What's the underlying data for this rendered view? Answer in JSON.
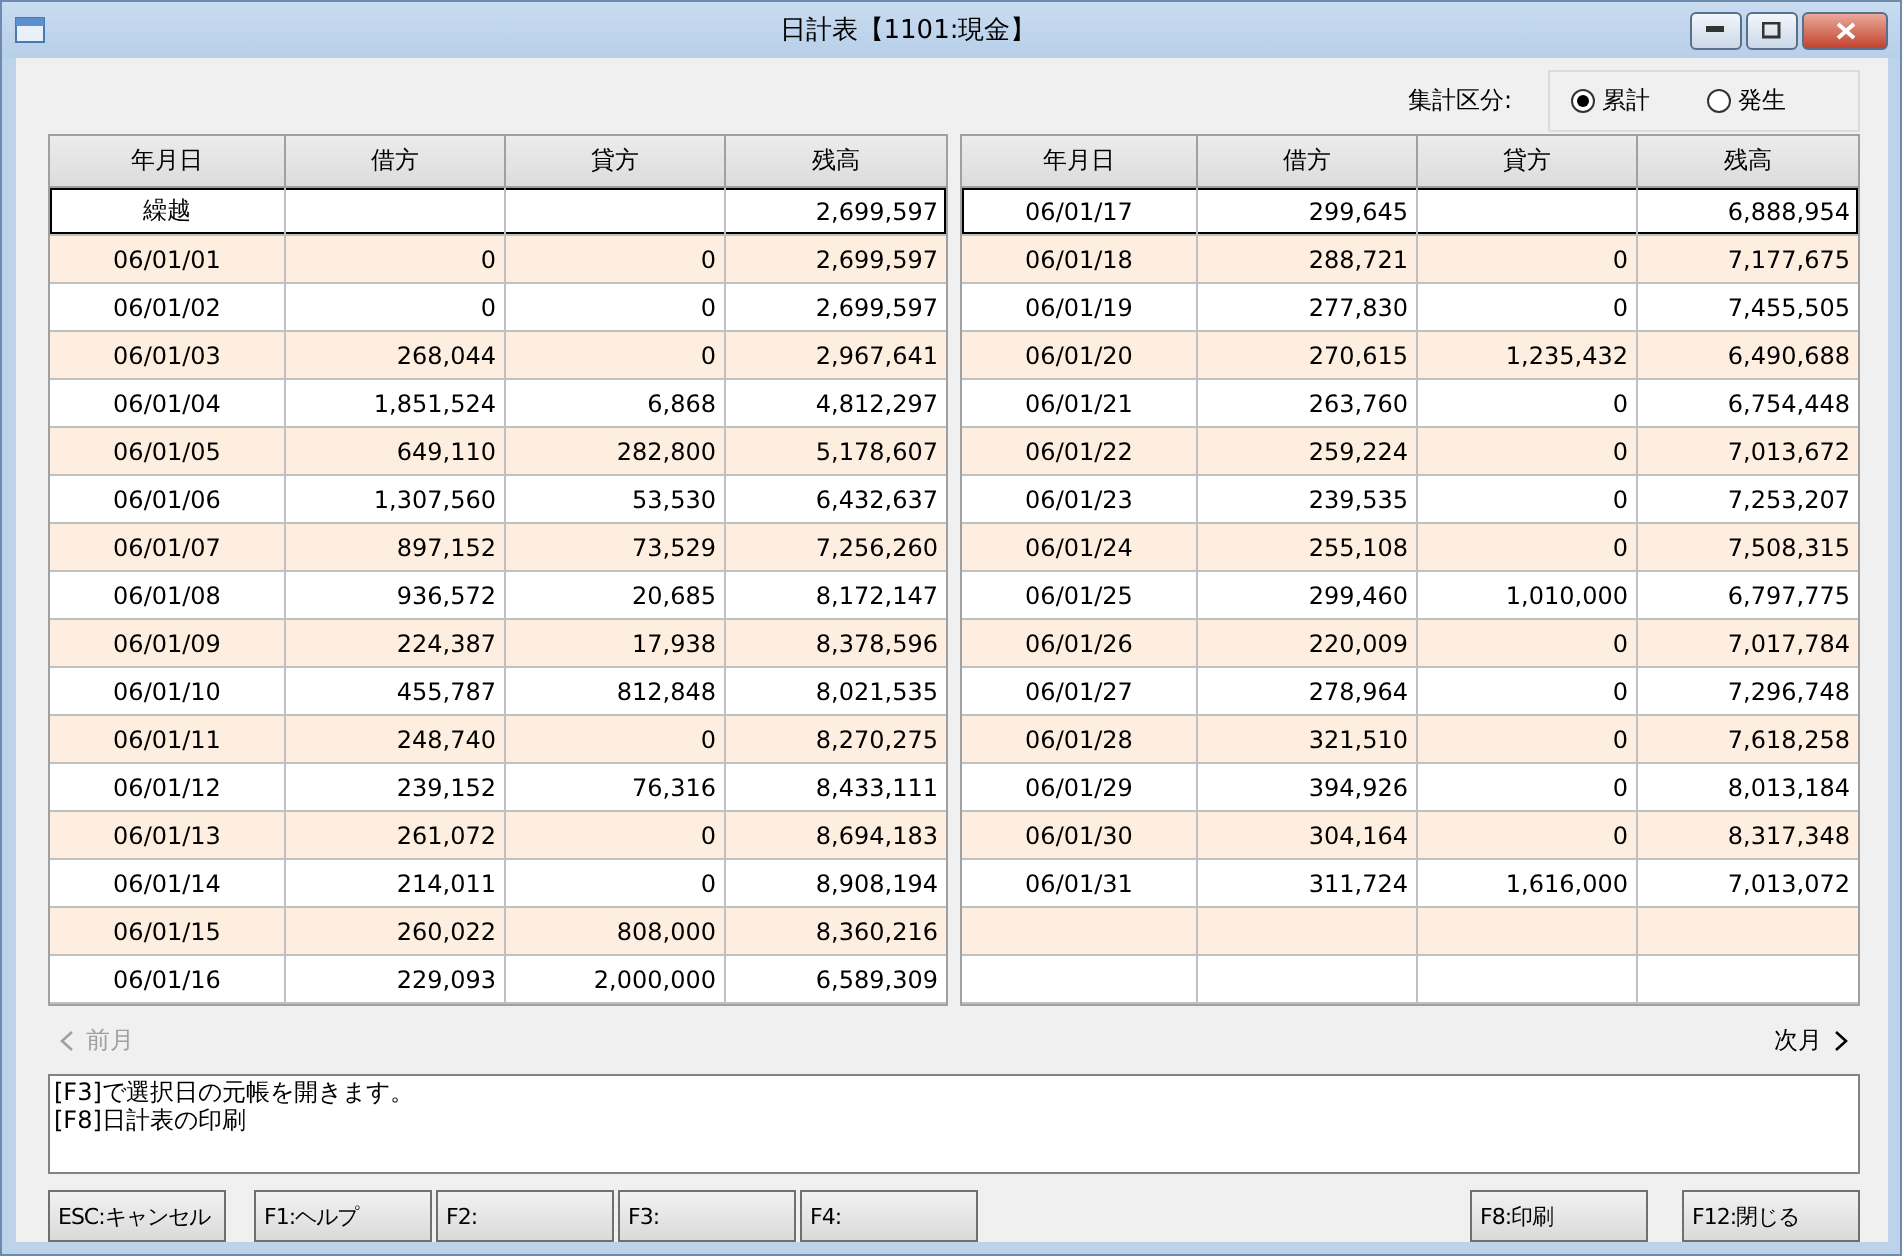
{
  "window": {
    "title": "日計表【1101:現金】"
  },
  "summary": {
    "label": "集計区分:",
    "options": [
      {
        "label": "累計",
        "selected": true
      },
      {
        "label": "発生",
        "selected": false
      }
    ]
  },
  "tables": [
    {
      "columns": [
        "年月日",
        "借方",
        "貸方",
        "残高"
      ],
      "rows": [
        {
          "cells": [
            "繰越",
            null,
            null,
            "2,699,597"
          ],
          "focused": true
        },
        {
          "cells": [
            "06/01/01",
            "0",
            "0",
            "2,699,597"
          ],
          "focused": false
        },
        {
          "cells": [
            "06/01/02",
            "0",
            "0",
            "2,699,597"
          ],
          "focused": false
        },
        {
          "cells": [
            "06/01/03",
            "268,044",
            "0",
            "2,967,641"
          ],
          "focused": false
        },
        {
          "cells": [
            "06/01/04",
            "1,851,524",
            "6,868",
            "4,812,297"
          ],
          "focused": false
        },
        {
          "cells": [
            "06/01/05",
            "649,110",
            "282,800",
            "5,178,607"
          ],
          "focused": false
        },
        {
          "cells": [
            "06/01/06",
            "1,307,560",
            "53,530",
            "6,432,637"
          ],
          "focused": false
        },
        {
          "cells": [
            "06/01/07",
            "897,152",
            "73,529",
            "7,256,260"
          ],
          "focused": false
        },
        {
          "cells": [
            "06/01/08",
            "936,572",
            "20,685",
            "8,172,147"
          ],
          "focused": false
        },
        {
          "cells": [
            "06/01/09",
            "224,387",
            "17,938",
            "8,378,596"
          ],
          "focused": false
        },
        {
          "cells": [
            "06/01/10",
            "455,787",
            "812,848",
            "8,021,535"
          ],
          "focused": false
        },
        {
          "cells": [
            "06/01/11",
            "248,740",
            "0",
            "8,270,275"
          ],
          "focused": false
        },
        {
          "cells": [
            "06/01/12",
            "239,152",
            "76,316",
            "8,433,111"
          ],
          "focused": false
        },
        {
          "cells": [
            "06/01/13",
            "261,072",
            "0",
            "8,694,183"
          ],
          "focused": false
        },
        {
          "cells": [
            "06/01/14",
            "214,011",
            "0",
            "8,908,194"
          ],
          "focused": false
        },
        {
          "cells": [
            "06/01/15",
            "260,022",
            "808,000",
            "8,360,216"
          ],
          "focused": false
        },
        {
          "cells": [
            "06/01/16",
            "229,093",
            "2,000,000",
            "6,589,309"
          ],
          "focused": false
        }
      ]
    },
    {
      "columns": [
        "年月日",
        "借方",
        "貸方",
        "残高"
      ],
      "rows": [
        {
          "cells": [
            "06/01/17",
            "299,645",
            null,
            "6,888,954"
          ],
          "focused": true
        },
        {
          "cells": [
            "06/01/18",
            "288,721",
            "0",
            "7,177,675"
          ],
          "focused": false
        },
        {
          "cells": [
            "06/01/19",
            "277,830",
            "0",
            "7,455,505"
          ],
          "focused": false
        },
        {
          "cells": [
            "06/01/20",
            "270,615",
            "1,235,432",
            "6,490,688"
          ],
          "focused": false
        },
        {
          "cells": [
            "06/01/21",
            "263,760",
            "0",
            "6,754,448"
          ],
          "focused": false
        },
        {
          "cells": [
            "06/01/22",
            "259,224",
            "0",
            "7,013,672"
          ],
          "focused": false
        },
        {
          "cells": [
            "06/01/23",
            "239,535",
            "0",
            "7,253,207"
          ],
          "focused": false
        },
        {
          "cells": [
            "06/01/24",
            "255,108",
            "0",
            "7,508,315"
          ],
          "focused": false
        },
        {
          "cells": [
            "06/01/25",
            "299,460",
            "1,010,000",
            "6,797,775"
          ],
          "focused": false
        },
        {
          "cells": [
            "06/01/26",
            "220,009",
            "0",
            "7,017,784"
          ],
          "focused": false
        },
        {
          "cells": [
            "06/01/27",
            "278,964",
            "0",
            "7,296,748"
          ],
          "focused": false
        },
        {
          "cells": [
            "06/01/28",
            "321,510",
            "0",
            "7,618,258"
          ],
          "focused": false
        },
        {
          "cells": [
            "06/01/29",
            "394,926",
            "0",
            "8,013,184"
          ],
          "focused": false
        },
        {
          "cells": [
            "06/01/30",
            "304,164",
            "0",
            "8,317,348"
          ],
          "focused": false
        },
        {
          "cells": [
            "06/01/31",
            "311,724",
            "1,616,000",
            "7,013,072"
          ],
          "focused": false
        },
        {
          "cells": [
            null,
            null,
            null,
            null
          ],
          "focused": false
        },
        {
          "cells": [
            null,
            null,
            null,
            null
          ],
          "focused": false
        }
      ]
    }
  ],
  "nav": {
    "prev": {
      "label": "前月",
      "disabled": true
    },
    "next": {
      "label": "次月",
      "disabled": false
    }
  },
  "messages": [
    "[F3]で選択日の元帳を開きます。",
    "[F8]日計表の印刷"
  ],
  "buttons_left": [
    "ESC:キャンセル",
    "F1:ヘルプ",
    "F2:",
    "F3:",
    "F4:"
  ],
  "buttons_right": [
    "F8:印刷",
    "F12:閉じる"
  ]
}
